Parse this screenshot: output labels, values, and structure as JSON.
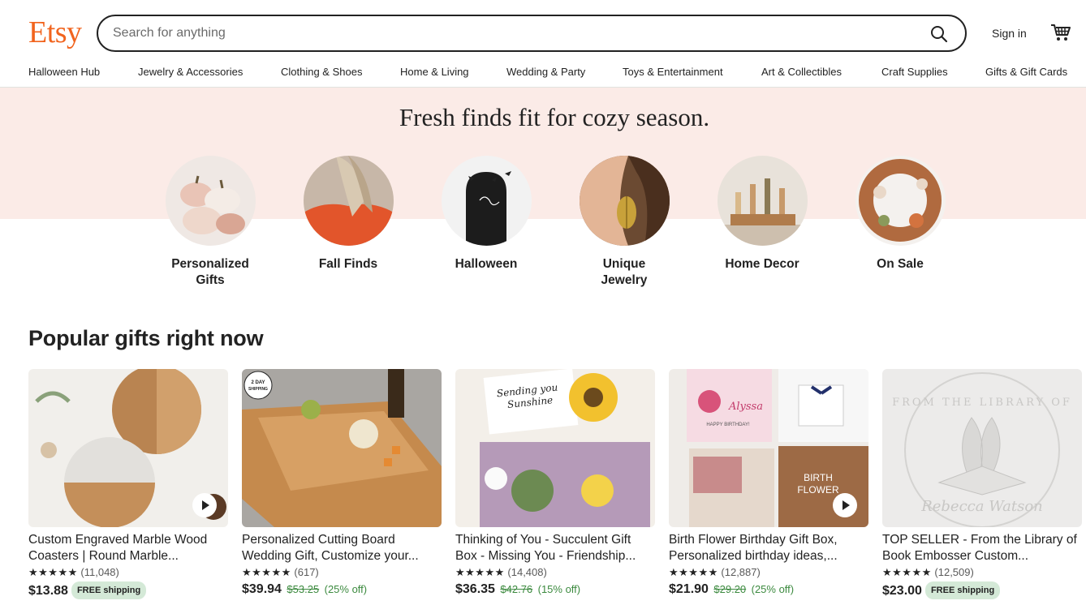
{
  "header": {
    "logo": "Etsy",
    "search_placeholder": "Search for anything",
    "sign_in": "Sign in"
  },
  "nav": {
    "items": [
      "Halloween Hub",
      "Jewelry & Accessories",
      "Clothing & Shoes",
      "Home & Living",
      "Wedding & Party",
      "Toys & Entertainment",
      "Art & Collectibles",
      "Craft Supplies",
      "Gifts & Gift Cards"
    ]
  },
  "banner": {
    "title": "Fresh finds fit for cozy season.",
    "categories": [
      {
        "label": "Personalized\nGifts"
      },
      {
        "label": "Fall Finds"
      },
      {
        "label": "Halloween"
      },
      {
        "label": "Unique\nJewelry"
      },
      {
        "label": "Home Decor"
      },
      {
        "label": "On Sale"
      }
    ]
  },
  "popular": {
    "title": "Popular gifts right now",
    "cards": [
      {
        "title": "Custom Engraved Marble Wood Coasters | Round Marble...",
        "stars": "★★★★★",
        "reviews": "(11,048)",
        "price": "$13.88",
        "old_price": "",
        "discount": "",
        "badge": "FREE shipping"
      },
      {
        "title": "Personalized Cutting Board Wedding Gift, Customize your...",
        "stars": "★★★★★",
        "reviews": "(617)",
        "price": "$39.94",
        "old_price": "$53.25",
        "discount": "(25% off)",
        "badge": ""
      },
      {
        "title": "Thinking of You - Succulent Gift Box - Missing You - Friendship...",
        "stars": "★★★★★",
        "reviews": "(14,408)",
        "price": "$36.35",
        "old_price": "$42.76",
        "discount": "(15% off)",
        "badge": ""
      },
      {
        "title": "Birth Flower Birthday Gift Box, Personalized birthday ideas,...",
        "stars": "★★★★★",
        "reviews": "(12,887)",
        "price": "$21.90",
        "old_price": "$29.20",
        "discount": "(25% off)",
        "badge": ""
      },
      {
        "title": "TOP SELLER - From the Library of Book Embosser Custom...",
        "stars": "★★★★★",
        "reviews": "(12,509)",
        "price": "$23.00",
        "old_price": "",
        "discount": "",
        "badge": "FREE shipping"
      }
    ]
  },
  "image_text": {
    "card2_badge": "2 DAY SHIPPING",
    "card3_sign": "Sending you Sunshine",
    "card4_name": "Alyssa",
    "card4_greeting": "HAPPY BIRTHDAY!",
    "card4_flower": "BIRTH FLOWER",
    "card5_emboss_top": "FROM THE LIBRARY OF",
    "card5_emboss_name": "Rebecca Watson"
  },
  "colors": {
    "brand": "#F1641E",
    "banner_bg": "#FBEBE7",
    "free_shipping_bg": "#D4E9D7",
    "sale_green": "#3c8a3f"
  },
  "icons": {
    "search": "search-icon",
    "cart": "cart-icon",
    "play": "play-icon"
  }
}
